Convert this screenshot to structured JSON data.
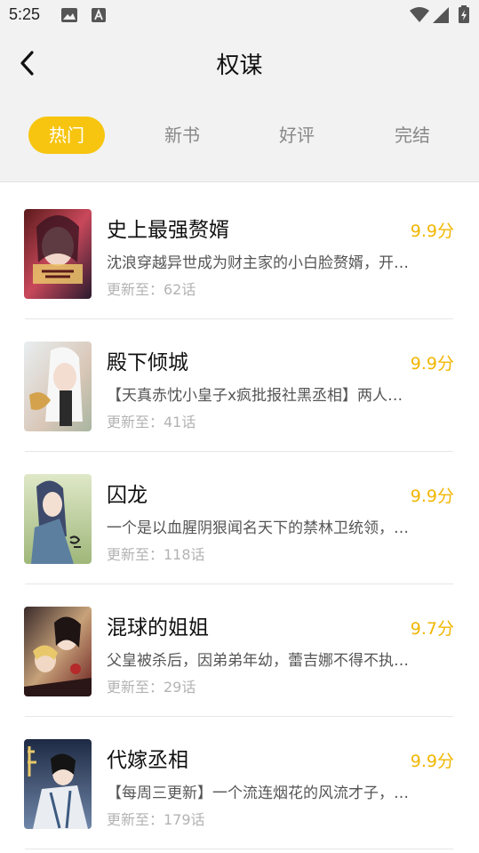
{
  "status_bar": {
    "time": "5:25",
    "icons": [
      "image-icon",
      "text-a-icon",
      "wifi-icon",
      "signal-icon",
      "battery-charging-icon"
    ]
  },
  "header": {
    "title": "权谋",
    "back_icon": "chevron-left-icon"
  },
  "tabs": [
    {
      "label": "热门",
      "active": true
    },
    {
      "label": "新书",
      "active": false
    },
    {
      "label": "好评",
      "active": false
    },
    {
      "label": "完结",
      "active": false
    }
  ],
  "colors": {
    "accent": "#f7c510",
    "score": "#f2b600",
    "background": "#f2f2f2"
  },
  "books": [
    {
      "title": "史上最强赘婿",
      "desc": "沈浪穿越异世成为财主家的小白脸赘婿，开局就被剥光捆在床上…",
      "update": "更新至：62话",
      "score": "9.9分"
    },
    {
      "title": "殿下倾城",
      "desc": "【天真赤忱小皇子x疯批报社黑丞相】两人携手破除宫廷阴谋…",
      "update": "更新至：41话",
      "score": "9.9分"
    },
    {
      "title": "囚龙",
      "desc": "一个是以血腥阴狠闻名天下的禁林卫统领，一个是失势的皇子…",
      "update": "更新至：118话",
      "score": "9.9分"
    },
    {
      "title": "混球的姐姐",
      "desc": "父皇被杀后，因弟弟年幼，蕾吉娜不得不执掌朝政对抗叛乱…",
      "update": "更新至：29话",
      "score": "9.7分"
    },
    {
      "title": "代嫁丞相",
      "desc": "【每周三更新】一个流连烟花的风流才子，一个冷面无情的丞相…",
      "update": "更新至：179话",
      "score": "9.9分"
    }
  ]
}
